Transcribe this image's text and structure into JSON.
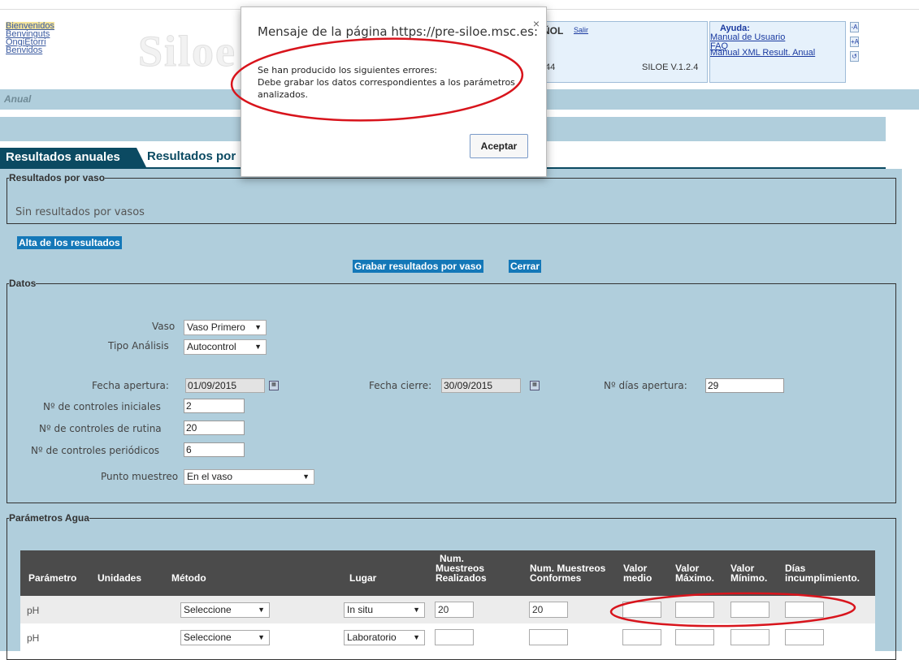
{
  "header": {
    "languages": [
      "Bienvenidos",
      "Benvinguts",
      "OngiEtorri",
      "Benvidos"
    ],
    "logo": "Siloe",
    "user_text": "ÑOL",
    "salir": "Salir",
    "user_number": ":44",
    "version": "SILOE V.1.2.4",
    "help": {
      "title": "Ayuda:",
      "links": [
        "Manual de Usuario",
        "FAQ",
        "Manual XML Result. Anual"
      ]
    },
    "font_controls": [
      "-A",
      "+A",
      "↺"
    ]
  },
  "page_title": "Anual",
  "tabs": [
    "Resultados anuales",
    "Resultados por"
  ],
  "vaso_section": {
    "legend": "Resultados por vaso",
    "empty_text": "Sin resultados por vasos"
  },
  "actions": {
    "alta": "Alta de los resultados",
    "grabar": "Grabar resultados por vaso",
    "cerrar": "Cerrar"
  },
  "datos": {
    "legend": "Datos",
    "vaso_label": "Vaso",
    "vaso_value": "Vaso Primero",
    "tipo_label": "Tipo Análisis",
    "tipo_value": "Autocontrol",
    "fecha_apertura_label": "Fecha apertura:",
    "fecha_apertura": "01/09/2015",
    "fecha_cierre_label": "Fecha cierre:",
    "fecha_cierre": "30/09/2015",
    "dias_label": "Nº días apertura:",
    "dias": "29",
    "iniciales_label": "Nº de controles iniciales",
    "iniciales": "2",
    "rutina_label": "Nº de controles de rutina",
    "rutina": "20",
    "periodicos_label": "Nº de controles periódicos",
    "periodicos": "6",
    "punto_label": "Punto muestreo",
    "punto_value": "En el vaso"
  },
  "parametros": {
    "legend": "Parámetros Agua",
    "headers": {
      "parametro": "Parámetro",
      "unidades": "Unidades",
      "metodo": "Método",
      "lugar": "Lugar",
      "num_realizados": [
        "Num.",
        "Muestreos",
        "Realizados"
      ],
      "num_conformes": [
        "Num. Muestreos",
        "Conformes"
      ],
      "valor_medio": [
        "Valor",
        "medio"
      ],
      "valor_maximo": [
        "Valor",
        "Máximo."
      ],
      "valor_minimo": [
        "Valor",
        "Mínimo."
      ],
      "dias_incumplimiento": [
        "Días",
        "incumplimiento."
      ]
    },
    "rows": [
      {
        "parametro": "pH",
        "metodo": "Seleccione",
        "lugar": "In situ",
        "realizados": "20",
        "conformes": "20",
        "medio": "",
        "maximo": "",
        "minimo": "",
        "dias": ""
      },
      {
        "parametro": "pH",
        "metodo": "Seleccione",
        "lugar": "Laboratorio",
        "realizados": "",
        "conformes": "",
        "medio": "",
        "maximo": "",
        "minimo": "",
        "dias": ""
      }
    ]
  },
  "dialog": {
    "title": "Mensaje de la página https://pre-siloe.msc.es:",
    "close": "×",
    "line1": "Se han producido los siguientes errores:",
    "line2": "Debe grabar los datos correspondientes a los parámetros analizados.",
    "button": "Aceptar"
  },
  "colors": {
    "panel": "#b0cedc",
    "tab": "#0b4a62",
    "button": "#1478b8",
    "table_header": "#4b4b4b",
    "annotation": "#d8141c"
  }
}
